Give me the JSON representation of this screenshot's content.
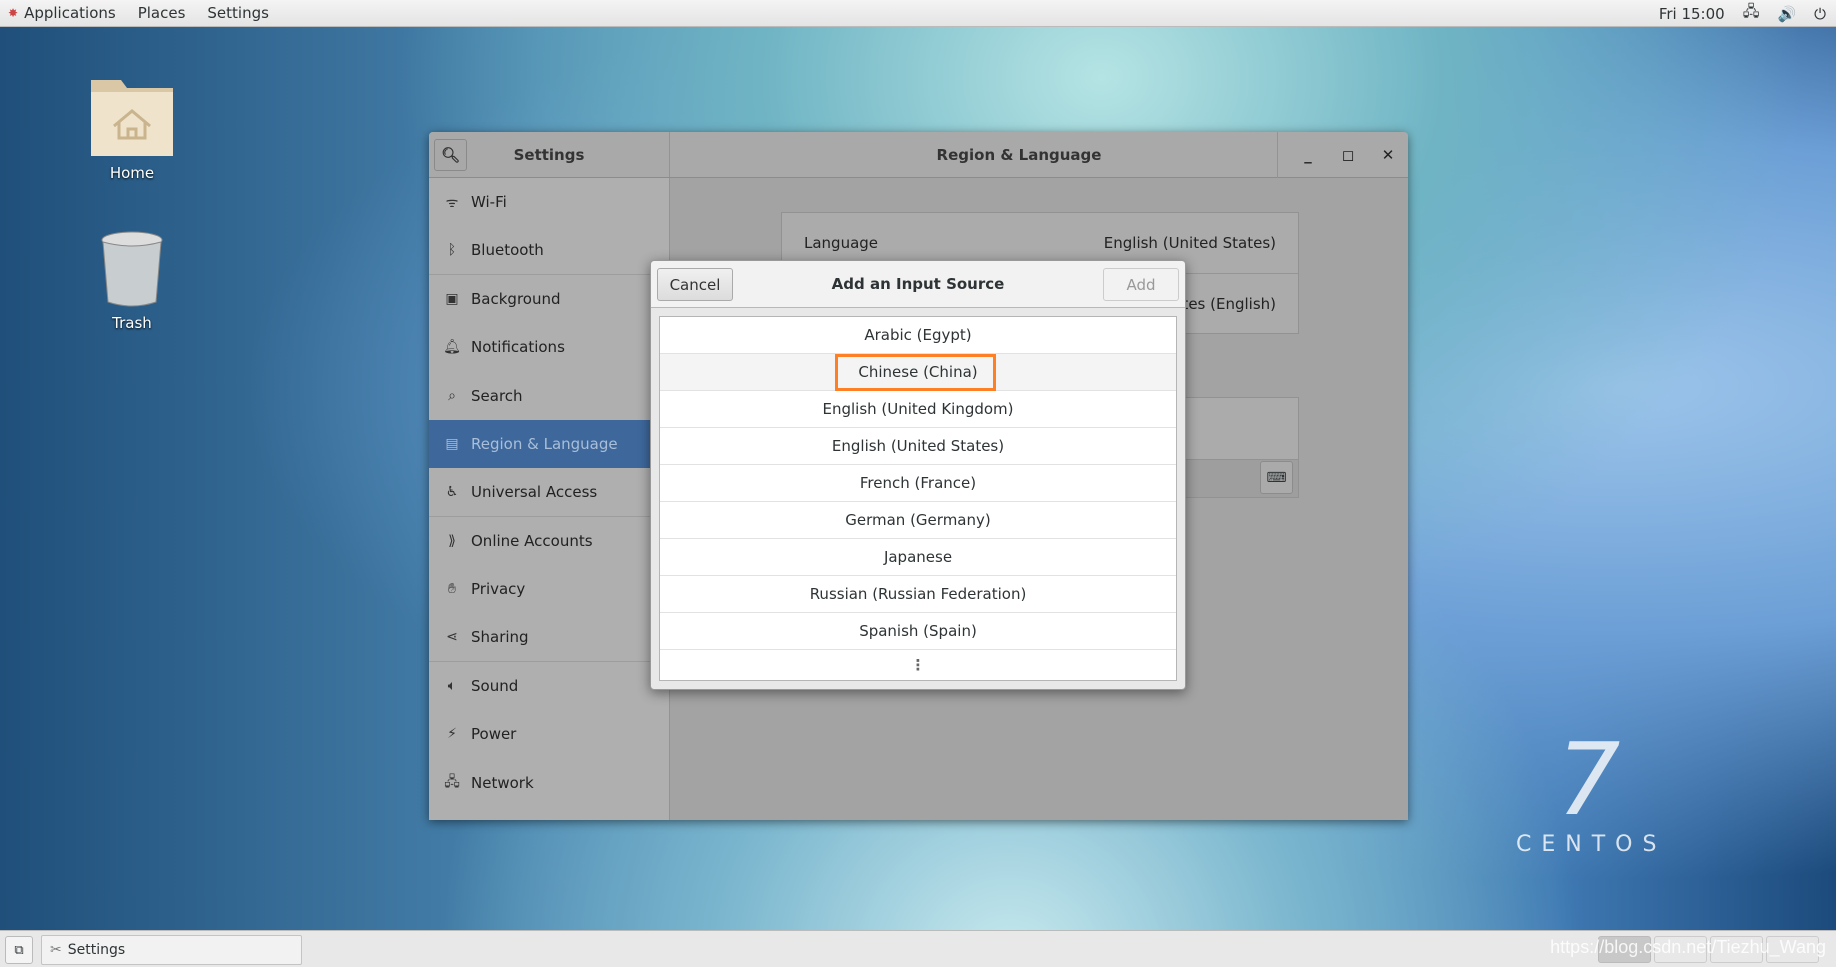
{
  "topbar": {
    "menus": [
      "Applications",
      "Places",
      "Settings"
    ],
    "clock": "Fri 15:00",
    "icons": [
      "network-icon",
      "volume-icon",
      "power-icon"
    ]
  },
  "desktop": {
    "icons": [
      {
        "label": "Home",
        "icon": "home-folder-icon"
      },
      {
        "label": "Trash",
        "icon": "trash-icon"
      }
    ],
    "brand": {
      "number": "7",
      "name": "CENTOS"
    }
  },
  "settings": {
    "title": "Settings",
    "panel_title": "Region & Language",
    "sidebar": [
      {
        "label": "Wi-Fi",
        "icon": "wifi-icon"
      },
      {
        "label": "Bluetooth",
        "icon": "bluetooth-icon"
      },
      {
        "label": "Background",
        "icon": "background-icon"
      },
      {
        "label": "Notifications",
        "icon": "bell-icon"
      },
      {
        "label": "Search",
        "icon": "search-icon"
      },
      {
        "label": "Region & Language",
        "icon": "region-icon",
        "selected": true
      },
      {
        "label": "Universal Access",
        "icon": "accessibility-icon"
      },
      {
        "label": "Online Accounts",
        "icon": "online-accounts-icon"
      },
      {
        "label": "Privacy",
        "icon": "hand-icon"
      },
      {
        "label": "Sharing",
        "icon": "share-icon"
      },
      {
        "label": "Sound",
        "icon": "speaker-icon"
      },
      {
        "label": "Power",
        "icon": "power-plug-icon"
      },
      {
        "label": "Network",
        "icon": "network-icon"
      }
    ],
    "language_label": "Language",
    "language_value": "English (United States)",
    "formats_value_partial": "tates (English)"
  },
  "dialog": {
    "title": "Add an Input Source",
    "cancel": "Cancel",
    "add": "Add",
    "items": [
      "Arabic (Egypt)",
      "Chinese (China)",
      "English (United Kingdom)",
      "English (United States)",
      "French (France)",
      "German (Germany)",
      "Japanese",
      "Russian (Russian Federation)",
      "Spanish (Spain)"
    ],
    "highlighted": "Chinese (China)",
    "highlight_color": "#ff7f24"
  },
  "taskbar": {
    "window_label": "Settings",
    "watermark": "https://blog.csdn.net/Tiezhu_Wang"
  }
}
